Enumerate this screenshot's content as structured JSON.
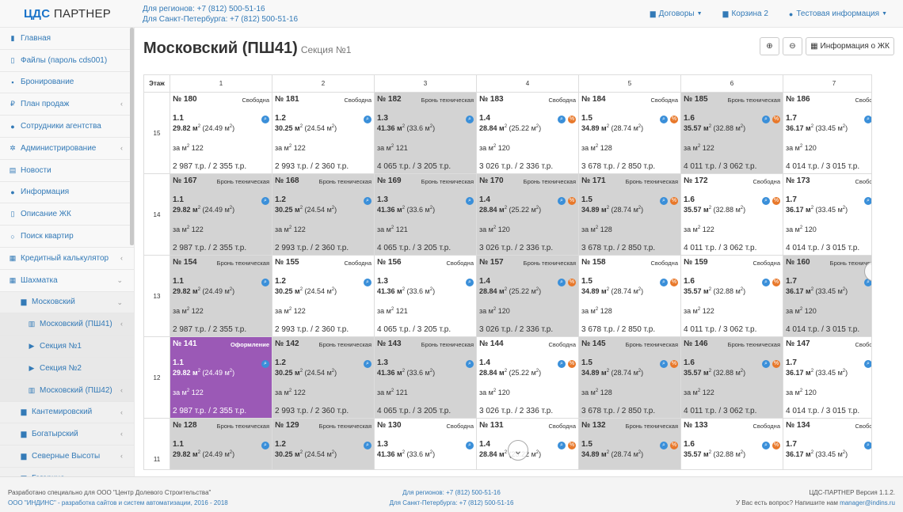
{
  "header": {
    "logo_main": "ЦДС",
    "logo_rest": "ПАРТНЕР",
    "phone_regions": "Для регионов: +7 (812) 500-51-16",
    "phone_spb": "Для Санкт-Петербурга: +7 (812) 500-51-16",
    "nav": {
      "contracts": "Договоры",
      "cart": "Корзина 2",
      "user": "Тестовая информация"
    }
  },
  "sidebar": {
    "items": [
      {
        "label": "Главная",
        "icon": "bookmark-icon",
        "level": 0,
        "chevron": false
      },
      {
        "label": "Файлы (пароль cds001)",
        "icon": "file-icon",
        "level": 0,
        "chevron": false
      },
      {
        "label": "Бронирование",
        "icon": "lock-icon",
        "level": 0,
        "chevron": false
      },
      {
        "label": "План продаж",
        "icon": "ruble-icon",
        "level": 0,
        "chevron": true
      },
      {
        "label": "Сотрудники агентства",
        "icon": "users-icon",
        "level": 0,
        "chevron": false
      },
      {
        "label": "Администрирование",
        "icon": "cogs-icon",
        "level": 0,
        "chevron": true
      },
      {
        "label": "Новости",
        "icon": "newspaper-icon",
        "level": 0,
        "chevron": false
      },
      {
        "label": "Информация",
        "icon": "info-icon",
        "level": 0,
        "chevron": false
      },
      {
        "label": "Описание ЖК",
        "icon": "file-text-icon",
        "level": 0,
        "chevron": false
      },
      {
        "label": "Поиск квартир",
        "icon": "search-icon",
        "level": 0,
        "chevron": false
      },
      {
        "label": "Кредитный калькулятор",
        "icon": "calculator-icon",
        "level": 0,
        "chevron": true
      },
      {
        "label": "Шахматка",
        "icon": "grid-icon",
        "level": 0,
        "chevron": true
      },
      {
        "label": "Московский",
        "icon": "building-icon",
        "level": 1,
        "chevron": true
      },
      {
        "label": "Московский (ПШ41)",
        "icon": "building-o-icon",
        "level": 2,
        "chevron": true
      },
      {
        "label": "Секция №1",
        "icon": "play-square-icon",
        "level": 3,
        "chevron": false
      },
      {
        "label": "Секция №2",
        "icon": "play-square-icon",
        "level": 3,
        "chevron": false
      },
      {
        "label": "Московский (ПШ42)",
        "icon": "building-o-icon",
        "level": 2,
        "chevron": true
      },
      {
        "label": "Кантемировский",
        "icon": "building-icon",
        "level": 1,
        "chevron": true
      },
      {
        "label": "Богатырский",
        "icon": "building-icon",
        "level": 1,
        "chevron": true
      },
      {
        "label": "Северные Высоты",
        "icon": "building-icon",
        "level": 1,
        "chevron": true
      },
      {
        "label": "Гагарина",
        "icon": "building-icon",
        "level": 1,
        "chevron": true
      }
    ]
  },
  "page": {
    "title": "Московский (ПШ41)",
    "subtitle": "Секция №1",
    "info_button": "Информация о ЖК",
    "zoom_in_icon": "zoom-in-icon",
    "zoom_out_icon": "zoom-out-icon"
  },
  "grid": {
    "floor_header": "Этаж",
    "columns": [
      "1",
      "2",
      "3",
      "4",
      "5",
      "6",
      "7"
    ],
    "rows": [
      {
        "floor": "15",
        "cells": [
          {
            "num": "№ 180",
            "status": "Свободна",
            "state": "free",
            "type": "1.1",
            "area": "29.82 м",
            "living": "(24.49 м",
            "ppm": "122",
            "price": "2 987 т.р. / 2 355 т.р.",
            "orange": false
          },
          {
            "num": "№ 181",
            "status": "Свободна",
            "state": "free",
            "type": "1.2",
            "area": "30.25 м",
            "living": "(24.54 м",
            "ppm": "122",
            "price": "2 993 т.р. / 2 360 т.р.",
            "orange": false
          },
          {
            "num": "№ 182",
            "status": "Бронь техническая",
            "state": "tech",
            "type": "1.3",
            "area": "41.36 м",
            "living": "(33.6 м",
            "ppm": "121",
            "price": "4 065 т.р. / 3 205 т.р.",
            "orange": false
          },
          {
            "num": "№ 183",
            "status": "Свободна",
            "state": "free",
            "type": "1.4",
            "area": "28.84 м",
            "living": "(25.22 м",
            "ppm": "120",
            "price": "3 026 т.р. / 2 336 т.р.",
            "orange": true
          },
          {
            "num": "№ 184",
            "status": "Свободна",
            "state": "free",
            "type": "1.5",
            "area": "34.89 м",
            "living": "(28.74 м",
            "ppm": "128",
            "price": "3 678 т.р. / 2 850 т.р.",
            "orange": true
          },
          {
            "num": "№ 185",
            "status": "Бронь техническая",
            "state": "tech",
            "type": "1.6",
            "area": "35.57 м",
            "living": "(32.88 м",
            "ppm": "122",
            "price": "4 011 т.р. / 3 062 т.р.",
            "orange": true
          },
          {
            "num": "№ 186",
            "status": "Свободна",
            "state": "free",
            "type": "1.7",
            "area": "36.17 м",
            "living": "(33.45 м",
            "ppm": "120",
            "price": "4 014 т.р. / 3 015 т.р.",
            "orange": true
          }
        ]
      },
      {
        "floor": "14",
        "cells": [
          {
            "num": "№ 167",
            "status": "Бронь техническая",
            "state": "tech",
            "type": "1.1",
            "area": "29.82 м",
            "living": "(24.49 м",
            "ppm": "122",
            "price": "2 987 т.р. / 2 355 т.р.",
            "orange": false
          },
          {
            "num": "№ 168",
            "status": "Бронь техническая",
            "state": "tech",
            "type": "1.2",
            "area": "30.25 м",
            "living": "(24.54 м",
            "ppm": "122",
            "price": "2 993 т.р. / 2 360 т.р.",
            "orange": false
          },
          {
            "num": "№ 169",
            "status": "Бронь техническая",
            "state": "tech",
            "type": "1.3",
            "area": "41.36 м",
            "living": "(33.6 м",
            "ppm": "121",
            "price": "4 065 т.р. / 3 205 т.р.",
            "orange": false
          },
          {
            "num": "№ 170",
            "status": "Бронь техническая",
            "state": "tech",
            "type": "1.4",
            "area": "28.84 м",
            "living": "(25.22 м",
            "ppm": "120",
            "price": "3 026 т.р. / 2 336 т.р.",
            "orange": true
          },
          {
            "num": "№ 171",
            "status": "Бронь техническая",
            "state": "tech",
            "type": "1.5",
            "area": "34.89 м",
            "living": "(28.74 м",
            "ppm": "128",
            "price": "3 678 т.р. / 2 850 т.р.",
            "orange": true
          },
          {
            "num": "№ 172",
            "status": "Свободна",
            "state": "free",
            "type": "1.6",
            "area": "35.57 м",
            "living": "(32.88 м",
            "ppm": "122",
            "price": "4 011 т.р. / 3 062 т.р.",
            "orange": true
          },
          {
            "num": "№ 173",
            "status": "Свободна",
            "state": "free",
            "type": "1.7",
            "area": "36.17 м",
            "living": "(33.45 м",
            "ppm": "120",
            "price": "4 014 т.р. / 3 015 т.р.",
            "orange": true
          }
        ]
      },
      {
        "floor": "13",
        "cells": [
          {
            "num": "№ 154",
            "status": "Бронь техническая",
            "state": "tech",
            "type": "1.1",
            "area": "29.82 м",
            "living": "(24.49 м",
            "ppm": "122",
            "price": "2 987 т.р. / 2 355 т.р.",
            "orange": false
          },
          {
            "num": "№ 155",
            "status": "Свободна",
            "state": "free",
            "type": "1.2",
            "area": "30.25 м",
            "living": "(24.54 м",
            "ppm": "122",
            "price": "2 993 т.р. / 2 360 т.р.",
            "orange": false
          },
          {
            "num": "№ 156",
            "status": "Свободна",
            "state": "free",
            "type": "1.3",
            "area": "41.36 м",
            "living": "(33.6 м",
            "ppm": "121",
            "price": "4 065 т.р. / 3 205 т.р.",
            "orange": false
          },
          {
            "num": "№ 157",
            "status": "Бронь техническая",
            "state": "tech",
            "type": "1.4",
            "area": "28.84 м",
            "living": "(25.22 м",
            "ppm": "120",
            "price": "3 026 т.р. / 2 336 т.р.",
            "orange": true
          },
          {
            "num": "№ 158",
            "status": "Свободна",
            "state": "free",
            "type": "1.5",
            "area": "34.89 м",
            "living": "(28.74 м",
            "ppm": "128",
            "price": "3 678 т.р. / 2 850 т.р.",
            "orange": true
          },
          {
            "num": "№ 159",
            "status": "Свободна",
            "state": "free",
            "type": "1.6",
            "area": "35.57 м",
            "living": "(32.88 м",
            "ppm": "122",
            "price": "4 011 т.р. / 3 062 т.р.",
            "orange": true
          },
          {
            "num": "№ 160",
            "status": "Бронь техническая",
            "state": "tech",
            "type": "1.7",
            "area": "36.17 м",
            "living": "(33.45 м",
            "ppm": "120",
            "price": "4 014 т.р. / 3 015 т.р.",
            "orange": true
          }
        ]
      },
      {
        "floor": "12",
        "cells": [
          {
            "num": "№ 141",
            "status": "Оформление",
            "state": "form",
            "type": "1.1",
            "area": "29.82 м",
            "living": "(24.49 м",
            "ppm": "122",
            "price": "2 987 т.р. / 2 355 т.р.",
            "orange": false
          },
          {
            "num": "№ 142",
            "status": "Бронь техническая",
            "state": "tech",
            "type": "1.2",
            "area": "30.25 м",
            "living": "(24.54 м",
            "ppm": "122",
            "price": "2 993 т.р. / 2 360 т.р.",
            "orange": false
          },
          {
            "num": "№ 143",
            "status": "Бронь техническая",
            "state": "tech",
            "type": "1.3",
            "area": "41.36 м",
            "living": "(33.6 м",
            "ppm": "121",
            "price": "4 065 т.р. / 3 205 т.р.",
            "orange": false
          },
          {
            "num": "№ 144",
            "status": "Свободна",
            "state": "free",
            "type": "1.4",
            "area": "28.84 м",
            "living": "(25.22 м",
            "ppm": "120",
            "price": "3 026 т.р. / 2 336 т.р.",
            "orange": true
          },
          {
            "num": "№ 145",
            "status": "Бронь техническая",
            "state": "tech",
            "type": "1.5",
            "area": "34.89 м",
            "living": "(28.74 м",
            "ppm": "128",
            "price": "3 678 т.р. / 2 850 т.р.",
            "orange": true
          },
          {
            "num": "№ 146",
            "status": "Бронь техническая",
            "state": "tech",
            "type": "1.6",
            "area": "35.57 м",
            "living": "(32.88 м",
            "ppm": "122",
            "price": "4 011 т.р. / 3 062 т.р.",
            "orange": true
          },
          {
            "num": "№ 147",
            "status": "Свободна",
            "state": "free",
            "type": "1.7",
            "area": "36.17 м",
            "living": "(33.45 м",
            "ppm": "120",
            "price": "4 014 т.р. / 3 015 т.р.",
            "orange": true
          }
        ]
      },
      {
        "floor": "11",
        "cells": [
          {
            "num": "№ 128",
            "status": "Бронь техническая",
            "state": "tech",
            "type": "1.1",
            "area": "29.82 м",
            "living": "(24.49 м",
            "ppm": "",
            "price": "",
            "orange": false
          },
          {
            "num": "№ 129",
            "status": "Бронь техническая",
            "state": "tech",
            "type": "1.2",
            "area": "30.25 м",
            "living": "(24.54 м",
            "ppm": "",
            "price": "",
            "orange": false
          },
          {
            "num": "№ 130",
            "status": "Свободна",
            "state": "free",
            "type": "1.3",
            "area": "41.36 м",
            "living": "(33.6 м",
            "ppm": "",
            "price": "",
            "orange": false
          },
          {
            "num": "№ 131",
            "status": "Свободна",
            "state": "free",
            "type": "1.4",
            "area": "28.84 м",
            "living": "(25.22 м",
            "ppm": "",
            "price": "",
            "orange": true
          },
          {
            "num": "№ 132",
            "status": "Бронь техническая",
            "state": "tech",
            "type": "1.5",
            "area": "34.89 м",
            "living": "(28.74 м",
            "ppm": "",
            "price": "",
            "orange": true
          },
          {
            "num": "№ 133",
            "status": "Свободна",
            "state": "free",
            "type": "1.6",
            "area": "35.57 м",
            "living": "(32.88 м",
            "ppm": "",
            "price": "",
            "orange": true
          },
          {
            "num": "№ 134",
            "status": "Свободна",
            "state": "free",
            "type": "1.7",
            "area": "36.17 м",
            "living": "(33.45 м",
            "ppm": "",
            "price": "",
            "orange": true
          }
        ]
      }
    ],
    "ppm_prefix": "за м",
    "colors": {
      "tech": "#d3d3d3",
      "form": "#9b59b6",
      "free": "#ffffff"
    }
  },
  "footer": {
    "left1": "Разработано специально для ООО \"Центр Долевого Строительства\"",
    "left2": "ООО \"ИНДИНС\" - разработка сайтов и систем автоматизации, 2016 - 2018",
    "center1": "Для регионов: +7 (812) 500-51-16",
    "center2": "Для Санкт-Петербурга: +7 (812) 500-51-16",
    "right1": "ЦДС-ПАРТНЕР Версия 1.1.2.",
    "right2": "У Вас есть вопрос? Напишите нам ",
    "email": "manager@indins.ru"
  }
}
